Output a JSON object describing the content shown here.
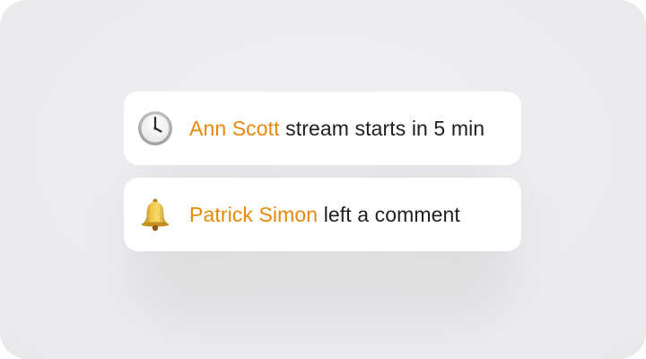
{
  "notifications": [
    {
      "icon": "clock-icon",
      "name": "Ann Scott",
      "message": "stream starts in 5 min"
    },
    {
      "icon": "bell-icon",
      "name": "Patrick Simon",
      "message": "left a comment"
    }
  ],
  "colors": {
    "accent": "#e8890c",
    "text": "#1f1f1f",
    "background": "#ececee",
    "card": "#ffffff"
  }
}
